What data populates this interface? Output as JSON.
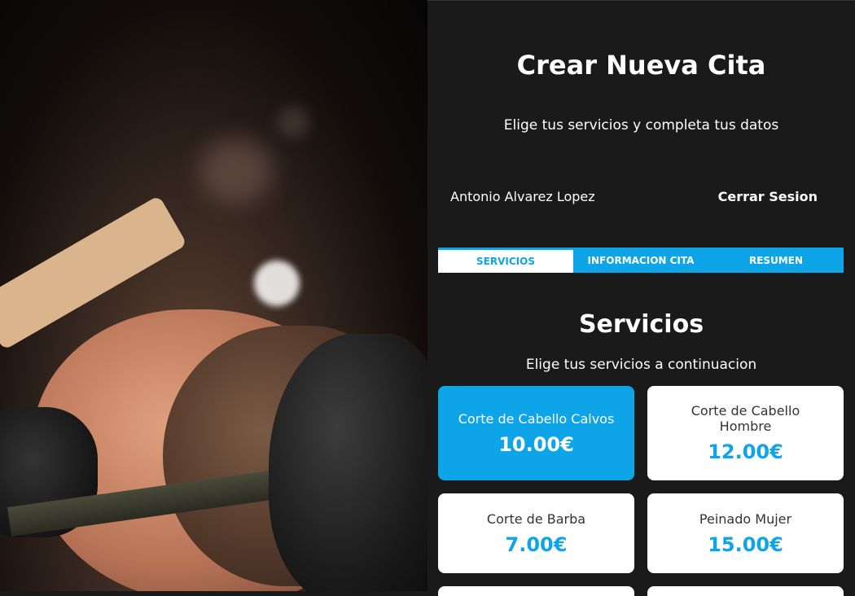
{
  "header": {
    "title": "Crear Nueva Cita",
    "subtitle": "Elige tus servicios y completa tus datos"
  },
  "user": {
    "name": "Antonio Alvarez Lopez",
    "logout_label": "Cerrar Sesion"
  },
  "tabs": [
    {
      "label": "Servicios",
      "active": true
    },
    {
      "label": "Informacion Cita",
      "active": false
    },
    {
      "label": "Resumen",
      "active": false
    }
  ],
  "services": {
    "title": "Servicios",
    "subtitle": "Elige tus servicios a continuacion",
    "items": [
      {
        "name": "Corte de Cabello Calvos",
        "price": "10.00€",
        "selected": true
      },
      {
        "name": "Corte de Cabello Hombre",
        "price": "12.00€",
        "selected": false
      },
      {
        "name": "Corte de Barba",
        "price": "7.00€",
        "selected": false
      },
      {
        "name": "Peinado Mujer",
        "price": "15.00€",
        "selected": false
      }
    ]
  },
  "colors": {
    "accent": "#0da5e8",
    "background": "#1a1a1a",
    "card": "#ffffff"
  }
}
